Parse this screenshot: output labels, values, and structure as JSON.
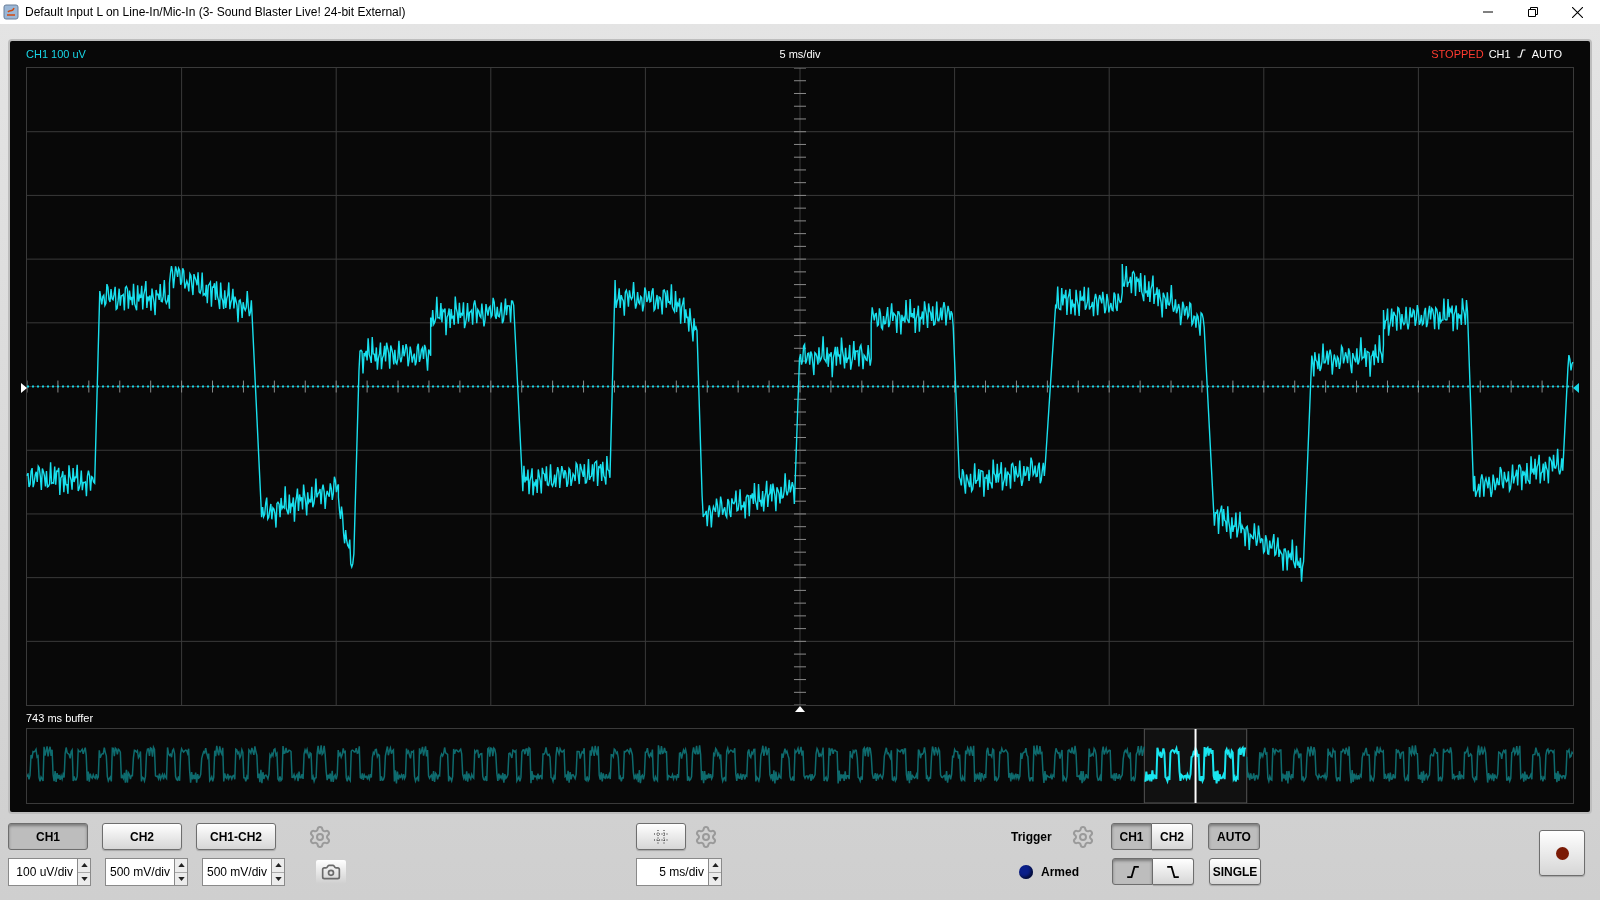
{
  "window": {
    "title": "Default Input L on Line-In/Mic-In (3- Sound Blaster Live! 24-bit External)"
  },
  "scope": {
    "channel_label": "CH1 100 uV",
    "timebase_label": "5 ms/div",
    "status": {
      "state": "STOPPED",
      "channel": "CH1",
      "edge": {
        "kind": "rising"
      },
      "mode": "AUTO"
    },
    "buffer_label": "743 ms buffer"
  },
  "channels": [
    {
      "label": "CH1",
      "selected": true,
      "scale": "100 uV/div"
    },
    {
      "label": "CH2",
      "selected": false,
      "scale": "500 mV/div"
    },
    {
      "label": "CH1-CH2",
      "selected": false,
      "scale": "500 mV/div"
    }
  ],
  "timebase": {
    "value": "5 ms/div"
  },
  "trigger": {
    "label": "Trigger",
    "channels": [
      {
        "label": "CH1",
        "selected": true
      },
      {
        "label": "CH2",
        "selected": false
      }
    ],
    "edges": [
      {
        "kind": "rising",
        "selected": true
      },
      {
        "kind": "falling",
        "selected": false
      }
    ],
    "modes": [
      {
        "label": "AUTO",
        "selected": true
      },
      {
        "label": "SINGLE",
        "selected": false
      }
    ],
    "armed": {
      "label": "Armed",
      "on": true
    }
  }
}
